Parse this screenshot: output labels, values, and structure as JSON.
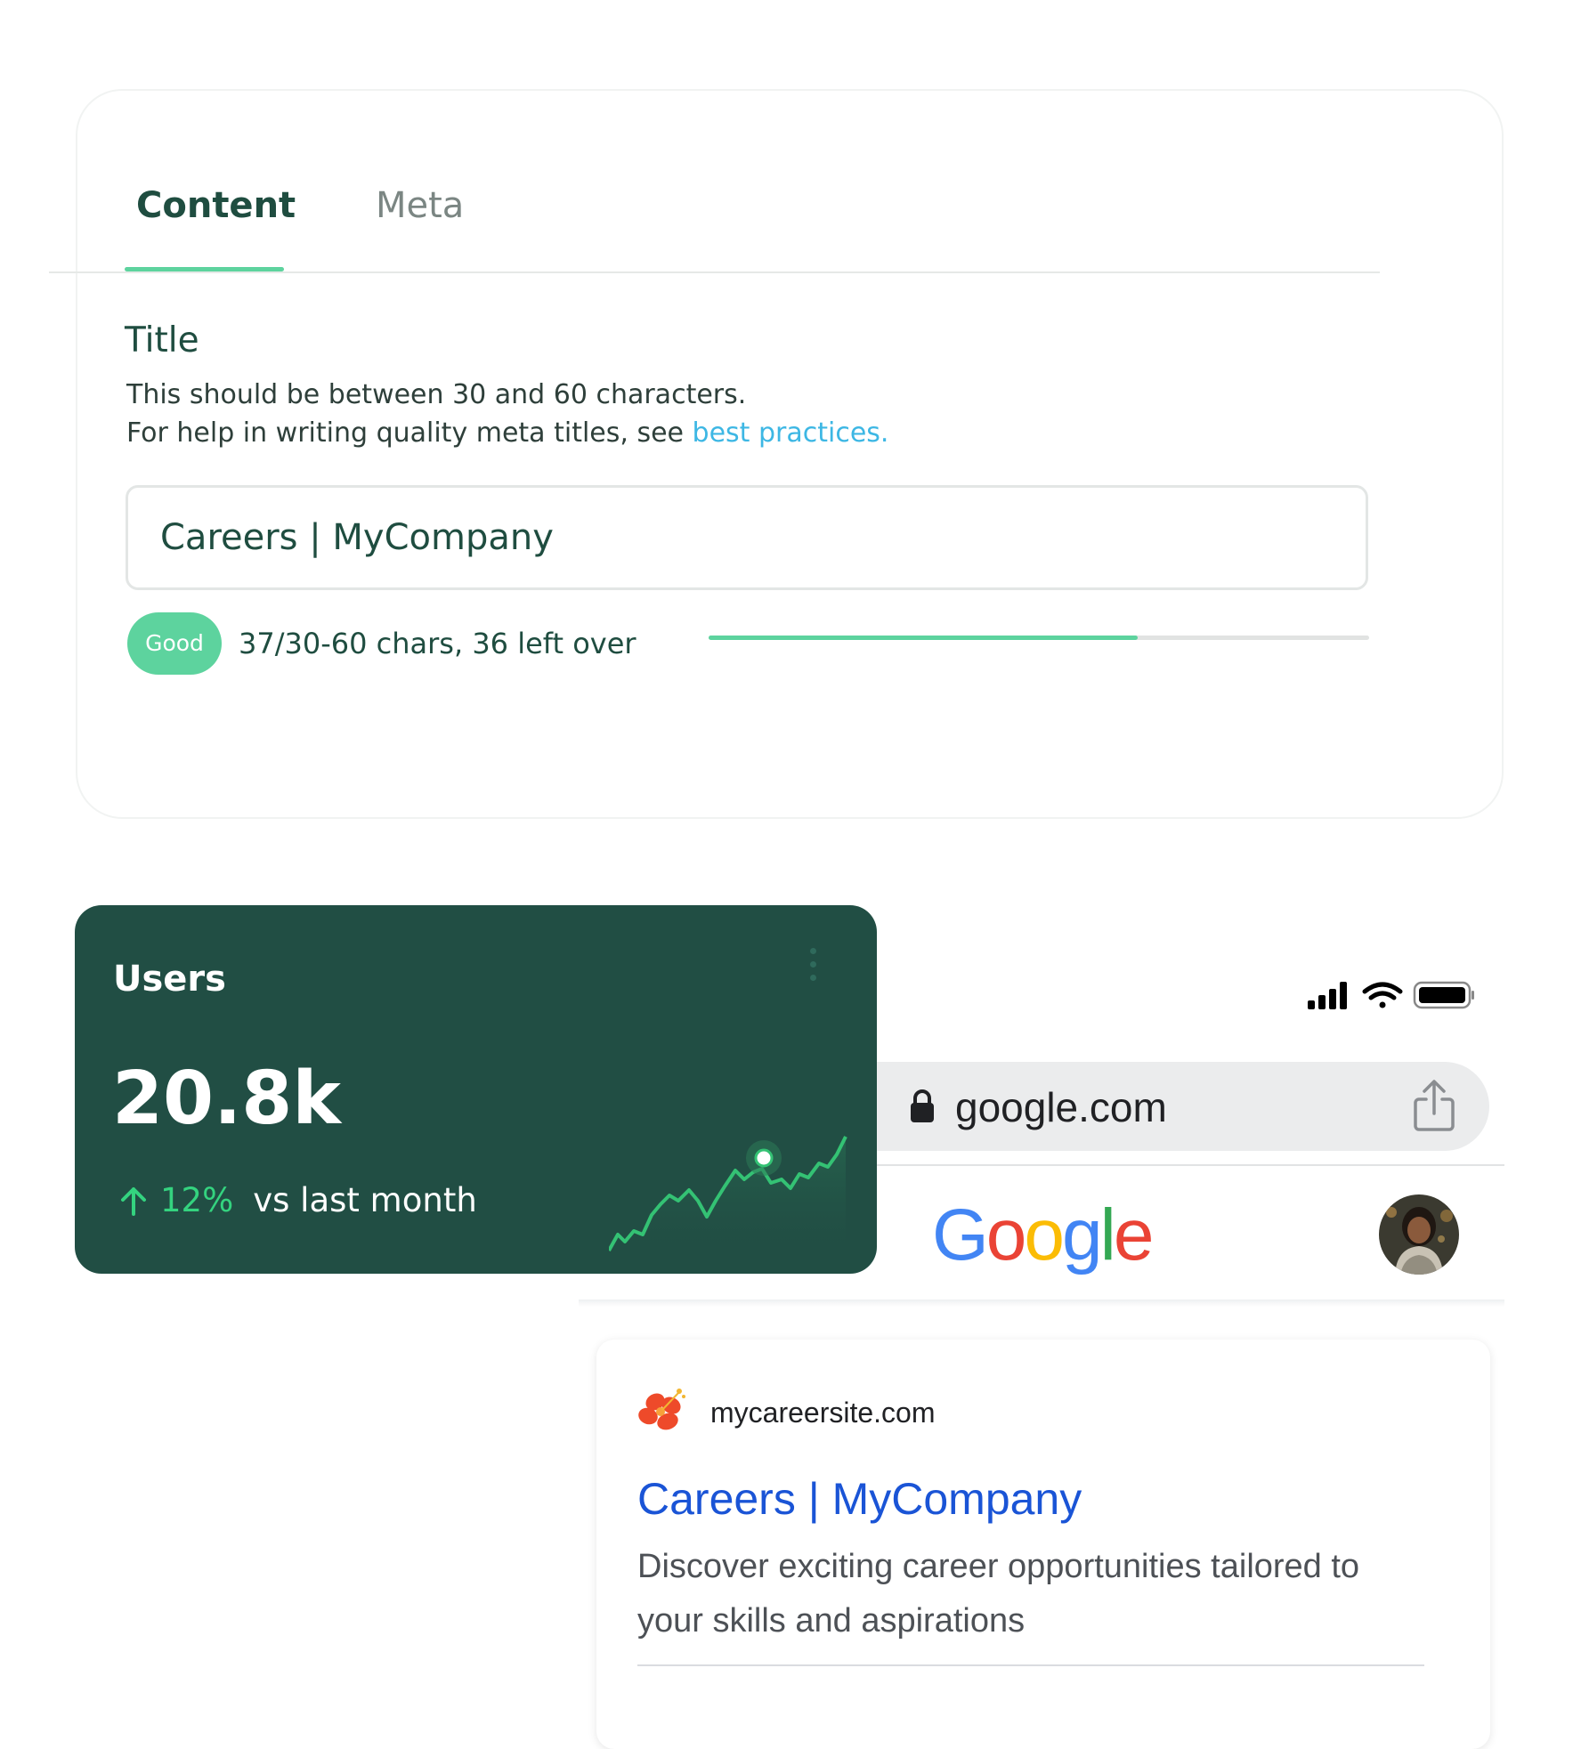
{
  "seo_editor": {
    "tabs": [
      {
        "label": "Content",
        "active": true
      },
      {
        "label": "Meta",
        "active": false
      }
    ],
    "field_title": "Title",
    "help_line1": "This should be between 30 and 60 characters.",
    "help_line2": "For help in writing quality meta titles, see ",
    "help_link": "best practices.",
    "title_value": "Careers | MyCompany",
    "badge": "Good",
    "char_count": "37/30-60 chars, 36 left over",
    "progress_fraction": 0.65,
    "accent_color": "#5dd39e"
  },
  "users_card": {
    "label": "Users",
    "value": "20.8k",
    "change": "12%",
    "comparison": "vs last month",
    "menu_icon": "kebab-menu-icon",
    "trend_icon": "arrow-up-icon",
    "background_color": "#214e44",
    "trend_color": "#34d37f"
  },
  "browser": {
    "url": "google.com",
    "lock_icon": "lock-icon",
    "share_icon": "share-icon",
    "status_icons": [
      "signal-icon",
      "wifi-icon",
      "battery-icon"
    ],
    "logo_text": "Google",
    "logo_colors": [
      "#4285f4",
      "#ea4335",
      "#fbbc05",
      "#4285f4",
      "#34a853",
      "#ea4335"
    ]
  },
  "search_result": {
    "domain": "mycareersite.com",
    "title": "Careers | MyCompany",
    "description": "Discover exciting career opportunities tailored to your skills and aspirations",
    "favicon_icon": "hibiscus-flower-icon",
    "title_color": "#1a54d6"
  }
}
